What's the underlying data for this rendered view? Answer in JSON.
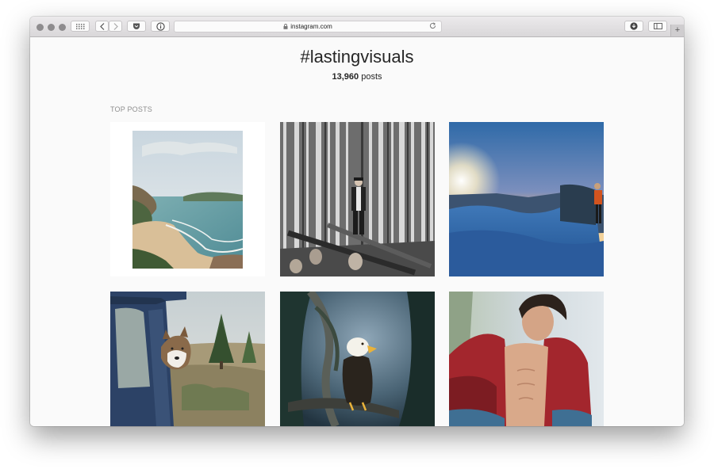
{
  "browser": {
    "url": "instagram.com",
    "new_tab_label": "+"
  },
  "page": {
    "hashtag": "#lastingvisuals",
    "post_count": "13,960",
    "post_count_suffix": "posts",
    "section_label": "TOP POSTS"
  },
  "posts": [
    {
      "name": "post-coastal-beach"
    },
    {
      "name": "post-birch-forest-man"
    },
    {
      "name": "post-snowy-sunset-hiker"
    },
    {
      "name": "post-husky-in-car"
    },
    {
      "name": "post-bald-eagle"
    },
    {
      "name": "post-man-red-jacket"
    }
  ],
  "colors": {
    "page_bg": "#fafafa",
    "text": "#262626",
    "muted": "#8e8e8e"
  }
}
